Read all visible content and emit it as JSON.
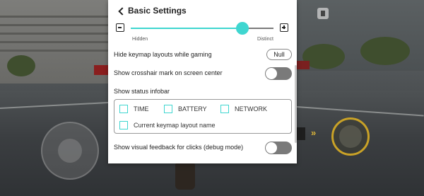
{
  "panel": {
    "title": "Basic Settings"
  },
  "opacity_slider": {
    "min_label": "Hidden",
    "max_label": "Distinct",
    "value_fraction": 0.78,
    "accent_color": "#3fd6d0"
  },
  "hide_keymap": {
    "label": "Hide keymap layouts while gaming",
    "button_label": "Null"
  },
  "crosshair": {
    "label": "Show crosshair mark on screen center",
    "enabled": false
  },
  "status_infobar": {
    "label": "Show status infobar",
    "options": [
      {
        "label": "TIME",
        "checked": false
      },
      {
        "label": "BATTERY",
        "checked": false
      },
      {
        "label": "NETWORK",
        "checked": false
      },
      {
        "label": "Current keymap layout name",
        "checked": false
      }
    ]
  },
  "visual_feedback": {
    "label": "Show visual feedback for clicks (debug mode)",
    "enabled": false
  },
  "icons": {
    "back": "chevron-left-icon",
    "minus": "minus-square-icon",
    "plus": "plus-square-icon",
    "hud": "exit-icon",
    "fire": "fire-button-icon",
    "joystick": "joystick-icon"
  }
}
